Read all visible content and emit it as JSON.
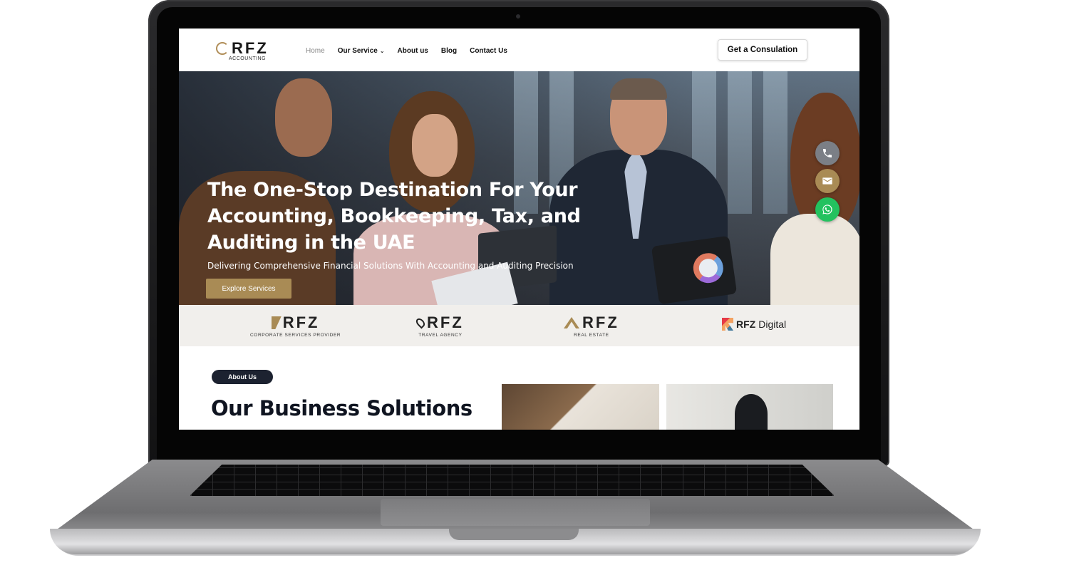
{
  "nav": {
    "logo_text": "RFZ",
    "logo_sub": "ACCOUNTING",
    "links": [
      {
        "label": "Home",
        "active": true
      },
      {
        "label": "Our Service",
        "has_dropdown": true
      },
      {
        "label": "About us"
      },
      {
        "label": "Blog"
      },
      {
        "label": "Contact Us"
      }
    ],
    "cta_label": "Get a Consulation"
  },
  "hero": {
    "title": "The One-Stop Destination For Your Accounting, Bookkeeping, Tax, and Auditing in the UAE",
    "subtitle": "Delivering Comprehensive Financial Solutions With Accounting and Auditing Precision",
    "button_label": "Explore Services"
  },
  "contact_fabs": [
    {
      "icon": "phone-icon",
      "color": "#7b7f86"
    },
    {
      "icon": "mail-icon",
      "color": "#a98b55"
    },
    {
      "icon": "whatsapp-icon",
      "color": "#23c25f"
    }
  ],
  "brands": [
    {
      "word": "RFZ",
      "sub": "CORPORATE SERVICES PROVIDER",
      "icon": "slash-logo-icon"
    },
    {
      "word": "RFZ",
      "sub": "TRAVEL AGENCY",
      "icon": "pin-logo-icon"
    },
    {
      "word": "RFZ",
      "sub": "REAL ESTATE",
      "icon": "roof-logo-icon"
    },
    {
      "word": "RFZ",
      "word2": "Digital",
      "icon": "digital-logo-icon"
    }
  ],
  "about": {
    "pill_label": "About Us",
    "section_title": "Our Business Solutions"
  },
  "colors": {
    "brand_gold": "#a98b55",
    "dark_navy": "#1c2230",
    "whatsapp_green": "#23c25f"
  }
}
